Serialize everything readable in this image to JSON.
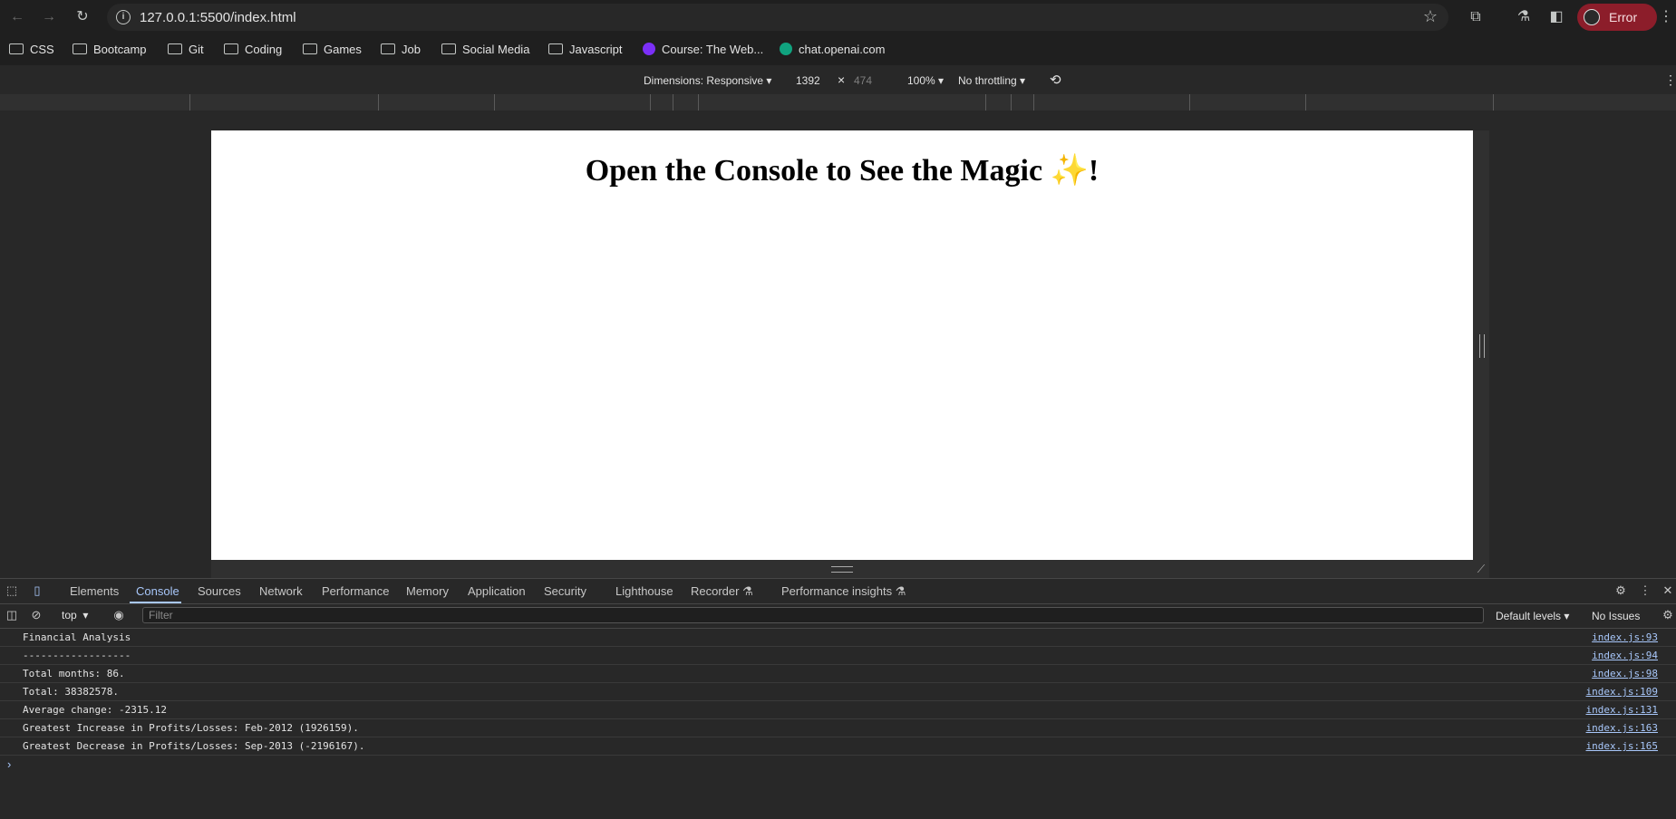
{
  "browser": {
    "url": "127.0.0.1:5500/index.html",
    "profile_status": "Error",
    "icons": {
      "back": "arrow-left-icon",
      "forward": "arrow-right-icon",
      "reload": "reload-icon",
      "info": "info-icon",
      "bookmark": "star-icon",
      "extensions": "puzzle-icon",
      "labs": "flask-icon",
      "side_panel": "side-panel-icon",
      "menu": "kebab-icon"
    }
  },
  "bookmarks": [
    {
      "label": "CSS",
      "type": "folder"
    },
    {
      "label": "Bootcamp",
      "type": "folder"
    },
    {
      "label": "Git",
      "type": "folder"
    },
    {
      "label": "Coding",
      "type": "folder"
    },
    {
      "label": "Games",
      "type": "folder"
    },
    {
      "label": "Job",
      "type": "folder"
    },
    {
      "label": "Social Media",
      "type": "folder"
    },
    {
      "label": "Javascript",
      "type": "folder"
    },
    {
      "label": "Course: The Web...",
      "type": "site",
      "color": "#7b2ff7"
    },
    {
      "label": "chat.openai.com",
      "type": "site",
      "color": "#10a37f"
    }
  ],
  "device_toolbar": {
    "dimensions_label": "Dimensions: Responsive",
    "width": "1392",
    "times": "×",
    "height": "474",
    "zoom": "100%",
    "throttling": "No throttling"
  },
  "page": {
    "heading": "Open the Console to See the Magic ✨!"
  },
  "devtools": {
    "tabs": [
      "Elements",
      "Console",
      "Sources",
      "Network",
      "Performance",
      "Memory",
      "Application",
      "Security",
      "Lighthouse",
      "Recorder",
      "Performance insights"
    ],
    "active_tab": "Console",
    "context": "top",
    "filter_placeholder": "Filter",
    "levels": "Default levels",
    "issues": "No Issues",
    "console_rows": [
      {
        "message": "Financial Analysis",
        "source": "index.js:93"
      },
      {
        "message": "------------------",
        "source": "index.js:94"
      },
      {
        "message": "Total months: 86.",
        "source": "index.js:98"
      },
      {
        "message": "Total: 38382578.",
        "source": "index.js:109"
      },
      {
        "message": "Average change: -2315.12",
        "source": "index.js:131"
      },
      {
        "message": "Greatest Increase in Profits/Losses: Feb-2012 (1926159).",
        "source": "index.js:163"
      },
      {
        "message": "Greatest Decrease in Profits/Losses: Sep-2013 (-2196167).",
        "source": "index.js:165"
      }
    ]
  },
  "colors": {
    "accent": "#a8c7fa",
    "error_pill": "#8c1d2a",
    "panel": "#282828"
  }
}
